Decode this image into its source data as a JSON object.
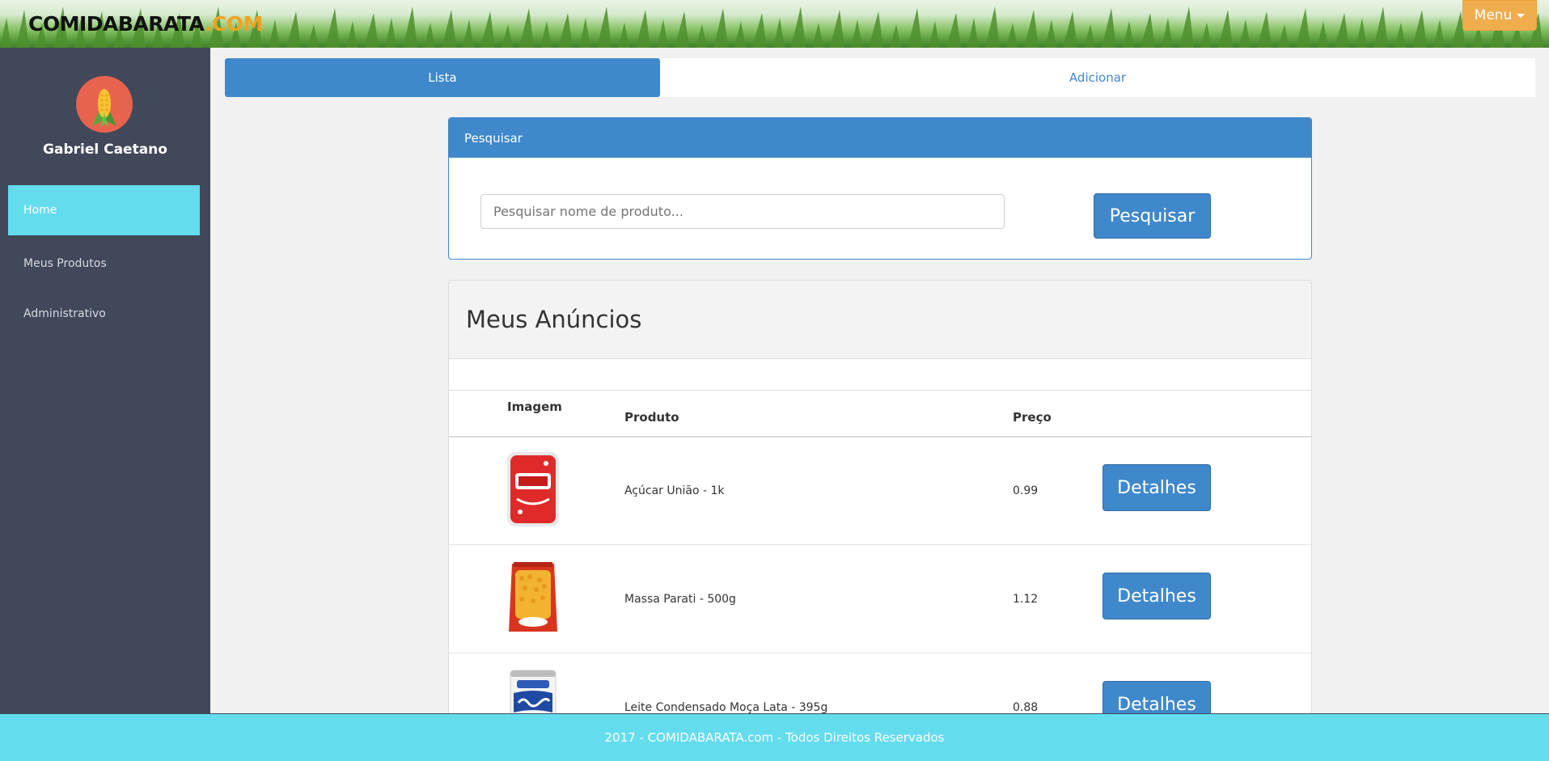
{
  "header": {
    "logo_main": "COMIDABARATA",
    "logo_suffix": ".COM",
    "menu_label": "Menu"
  },
  "sidebar": {
    "username": "Gabriel Caetano",
    "items": [
      {
        "label": "Home",
        "active": true
      },
      {
        "label": "Meus Produtos",
        "active": false
      },
      {
        "label": "Administrativo",
        "active": false
      }
    ]
  },
  "tabs": [
    {
      "label": "Lista",
      "active": true
    },
    {
      "label": "Adicionar",
      "active": false
    }
  ],
  "search": {
    "title": "Pesquisar",
    "placeholder": "Pesquisar nome de produto...",
    "value": "",
    "button_label": "Pesquisar"
  },
  "ads": {
    "title": "Meus Anúncios",
    "columns": [
      "Imagem",
      "Produto",
      "Preço"
    ],
    "rows": [
      {
        "product": "Açúcar União - 1k",
        "price": "0.99",
        "button": "Detalhes",
        "image_icon": "acucar-uniao-package-image"
      },
      {
        "product": "Massa Parati - 500g",
        "price": "1.12",
        "button": "Detalhes",
        "image_icon": "massa-parati-package-image"
      },
      {
        "product": "Leite Condensado Moça Lata - 395g",
        "price": "0.88",
        "button": "Detalhes",
        "image_icon": "leite-moca-can-image"
      }
    ]
  },
  "footer": {
    "text": "2017 - COMIDABARATA.com - Todos Direitos Reservados"
  },
  "colors": {
    "primary": "#3f88cc",
    "sidebar_bg": "#404859",
    "accent_cyan": "#63dcee",
    "menu_orange": "#f0ad4e",
    "avatar_red": "#e8634e"
  }
}
